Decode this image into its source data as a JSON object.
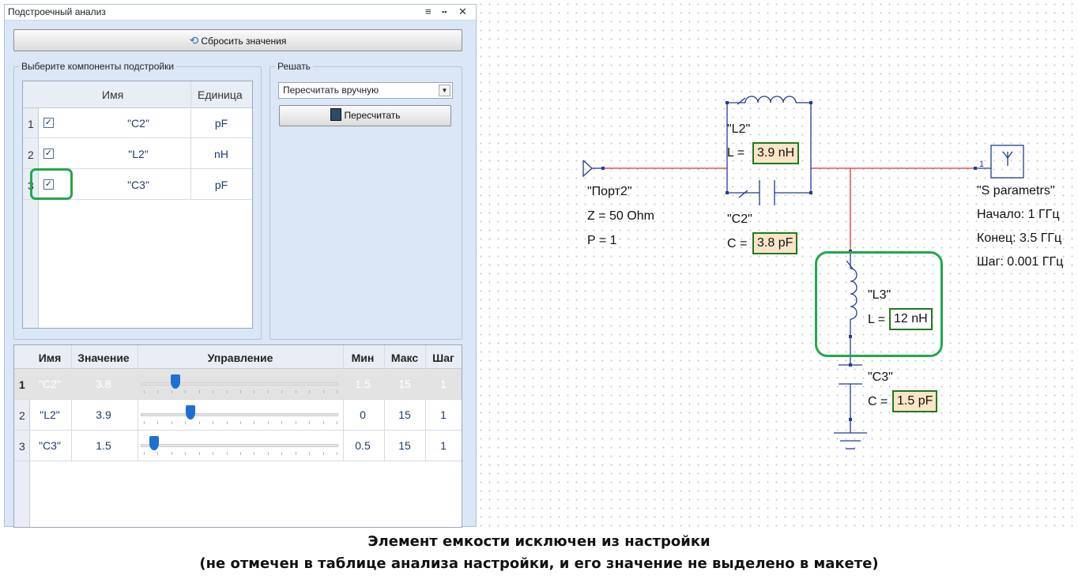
{
  "panel": {
    "title": "Подстроечный анализ",
    "icons": {
      "menu": "≡",
      "layout": "▪▪",
      "close": "✕"
    }
  },
  "reset_button": {
    "label": "Сбросить значения",
    "icon": "refresh-icon"
  },
  "components_group": {
    "legend": "Выберите компоненты подстройки",
    "columns": {
      "name": "Имя",
      "unit": "Единица"
    },
    "rows": [
      {
        "num": "1",
        "checked": true,
        "name": "\"C2\"",
        "unit": "pF"
      },
      {
        "num": "2",
        "checked": true,
        "name": "\"L2\"",
        "unit": "nH"
      },
      {
        "num": "3",
        "checked": true,
        "name": "\"C3\"",
        "unit": "pF"
      }
    ]
  },
  "solve_group": {
    "legend": "Решать",
    "mode_select": "Пересчитать вручную",
    "recalc_button": "Пересчитать"
  },
  "tuning_table": {
    "columns": {
      "name": "Имя",
      "value": "Значение",
      "control": "Управление",
      "min": "Мин",
      "max": "Макс",
      "step": "Шаг"
    },
    "rows": [
      {
        "num": "1",
        "name": "\"C2\"",
        "value": "3.8",
        "min": "1.5",
        "max": "15",
        "step": "1",
        "level": 0.18,
        "disabled": true
      },
      {
        "num": "2",
        "name": "\"L2\"",
        "value": "3.9",
        "min": "0",
        "max": "15",
        "step": "1",
        "level": 0.26,
        "disabled": false
      },
      {
        "num": "3",
        "name": "\"C3\"",
        "value": "1.5",
        "min": "0.5",
        "max": "15",
        "step": "1",
        "level": 0.07,
        "disabled": false
      }
    ]
  },
  "schematic": {
    "port": {
      "name": "\"Порт2\"",
      "z": "Z =  50 Ohm",
      "p": "P =  1"
    },
    "l2": {
      "name": "\"L2\"",
      "prefix": "L =",
      "value": "3.9 nH",
      "tuned": true
    },
    "c2": {
      "name": "\"C2\"",
      "prefix": "C =",
      "value": "3.8 pF",
      "tuned": true
    },
    "l3": {
      "name": "\"L3\"",
      "prefix": "L =",
      "value": "12 nH",
      "tuned": false
    },
    "c3": {
      "name": "\"C3\"",
      "prefix": "C =",
      "value": "1.5 pF",
      "tuned": true
    },
    "sparams": {
      "name": "\"S parametrs\"",
      "start": "Начало:  1 ГГц",
      "end": "Конец:  3.5 ГГц",
      "step": "Шаг:  0.001 ГГц",
      "pin": "1"
    },
    "colors": {
      "wire": "#e03030",
      "component": "#1f3c99",
      "highlight": "#22a84a"
    }
  },
  "caption": {
    "line1": "Элемент емкости исключен из настройки",
    "line2": "(не отмечен в таблице анализа настройки, и его значение не выделено в макете)"
  }
}
